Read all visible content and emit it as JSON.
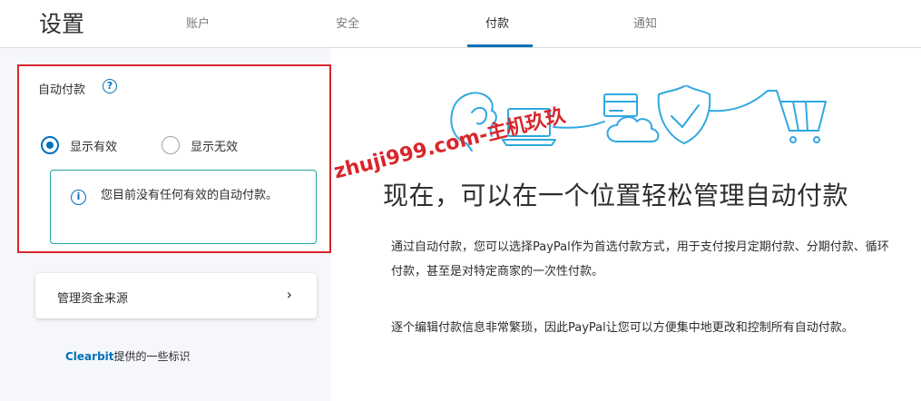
{
  "header": {
    "title": "设置",
    "tabs": [
      {
        "label": "账户",
        "active": false
      },
      {
        "label": "安全",
        "active": false
      },
      {
        "label": "付款",
        "active": true
      },
      {
        "label": "通知",
        "active": false
      }
    ]
  },
  "auto_pay": {
    "title": "自动付款",
    "help_icon": "?",
    "options": [
      {
        "label": "显示有效",
        "selected": true
      },
      {
        "label": "显示无效",
        "selected": false
      }
    ],
    "notice_icon": "i",
    "notice_text": "您目前没有任何有效的自动付款。"
  },
  "funding": {
    "label": "管理资金来源",
    "chevron": "›"
  },
  "clearbit": {
    "brand": "Clearbit",
    "text": "提供的一些标识"
  },
  "watermark": "zhuji999.com-主机玖玖",
  "main": {
    "headline": "现在，可以在一个位置轻松管理自动付款",
    "paragraph1": "通过自动付款，您可以选择PayPal作为首选付款方式，用于支付按月定期付款、分期付款、循环付款，甚至是对特定商家的一次性付款。",
    "paragraph2": "逐个编辑付款信息非常繁琐，因此PayPal让您可以方便集中地更改和控制所有自动付款。"
  },
  "colors": {
    "accent": "#0070ba",
    "highlight_border": "#d8262c",
    "notice_border": "#1fa3a0",
    "illustration_stroke": "#2fa8e0"
  }
}
